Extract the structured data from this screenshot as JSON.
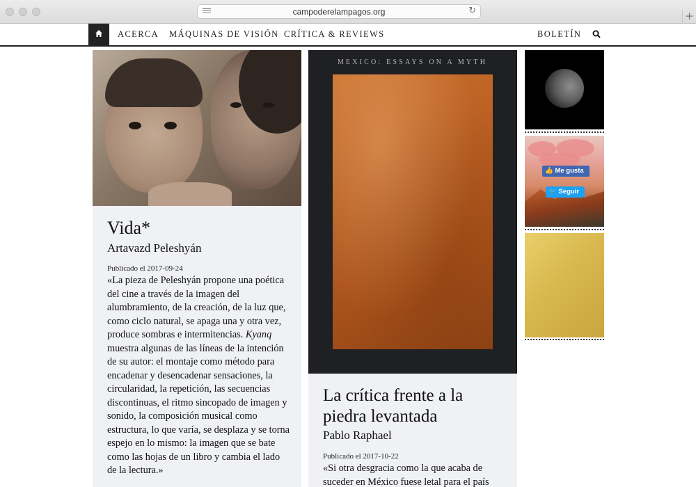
{
  "browser": {
    "url": "campoderelampagos.org",
    "new_tab_label": "+"
  },
  "nav": {
    "items": [
      "ACERCA",
      "MÁQUINAS DE VISIÓN",
      "CRÍTICA & REVIEWS"
    ],
    "newsletter": "BOLETÍN",
    "icons": [
      "home-icon",
      "search-icon"
    ]
  },
  "articles": [
    {
      "title": "Vida*",
      "author": "Artavazd Peleshyán",
      "published": "Publicado el 2017-09-24",
      "excerpt_parts": [
        "«La pieza de Peleshyán propone una poética del cine a través de la imagen del alumbramiento, de la creación, de la luz que, como ciclo natural, se apaga una y otra vez, produce sombras e intermitencias. ",
        "Kyanq",
        " muestra algunas de las líneas de la intención de su autor: el montaje como método para encadenar y desencadenar sensaciones, la circularidad, la repetición, las secuencias discontinuas, el ritmo sincopado de imagen y sonido, la composición musical como estructura, lo que varía, se desplaza y se torna espejo en lo mismo: la imagen que se bate como las hojas de un libro y cambia el lado de la lectura.»"
      ]
    },
    {
      "cover_text": "MEXICO: ESSAYS ON A MYTH",
      "title": "La crítica frente a la piedra levantada",
      "author": "Pablo Raphael",
      "published": "Publicado el 2017-10-22",
      "excerpt": "«Si otra desgracia como la que acaba de suceder en México fuese letal para el país"
    }
  ],
  "sidebar": {
    "like_label": "Me gusta",
    "follow_label": "Seguir"
  }
}
